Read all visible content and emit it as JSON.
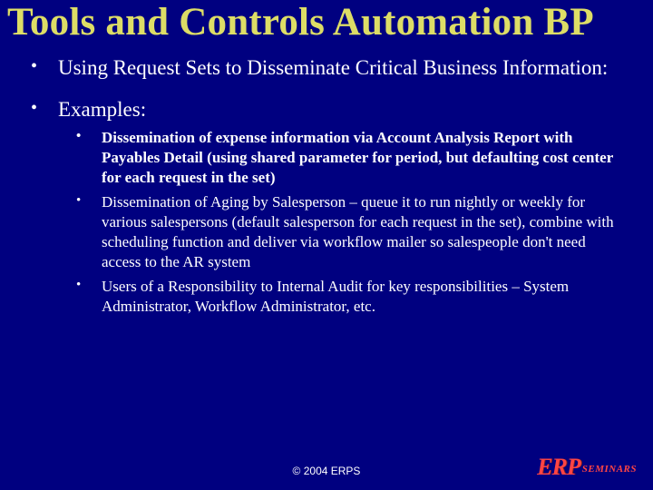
{
  "title": "Tools and Controls Automation BP",
  "bullets": {
    "b1": "Using Request Sets to Disseminate Critical Business Information:",
    "b2": "Examples:",
    "sub1": "Dissemination of expense information via Account Analysis Report with Payables Detail (using shared parameter for period, but defaulting cost center for each request in the set)",
    "sub2": "Dissemination of Aging by Salesperson – queue it to run nightly or weekly for various salespersons (default salesperson for each request in the set), combine with scheduling function and deliver via workflow mailer so salespeople don't need access to the AR system",
    "sub3": "Users of a Responsibility to Internal Audit for key responsibilities – System Administrator, Workflow Administrator, etc."
  },
  "footer": "© 2004 ERPS",
  "logo": {
    "big": "ERP",
    "small": "SEMINARS"
  }
}
